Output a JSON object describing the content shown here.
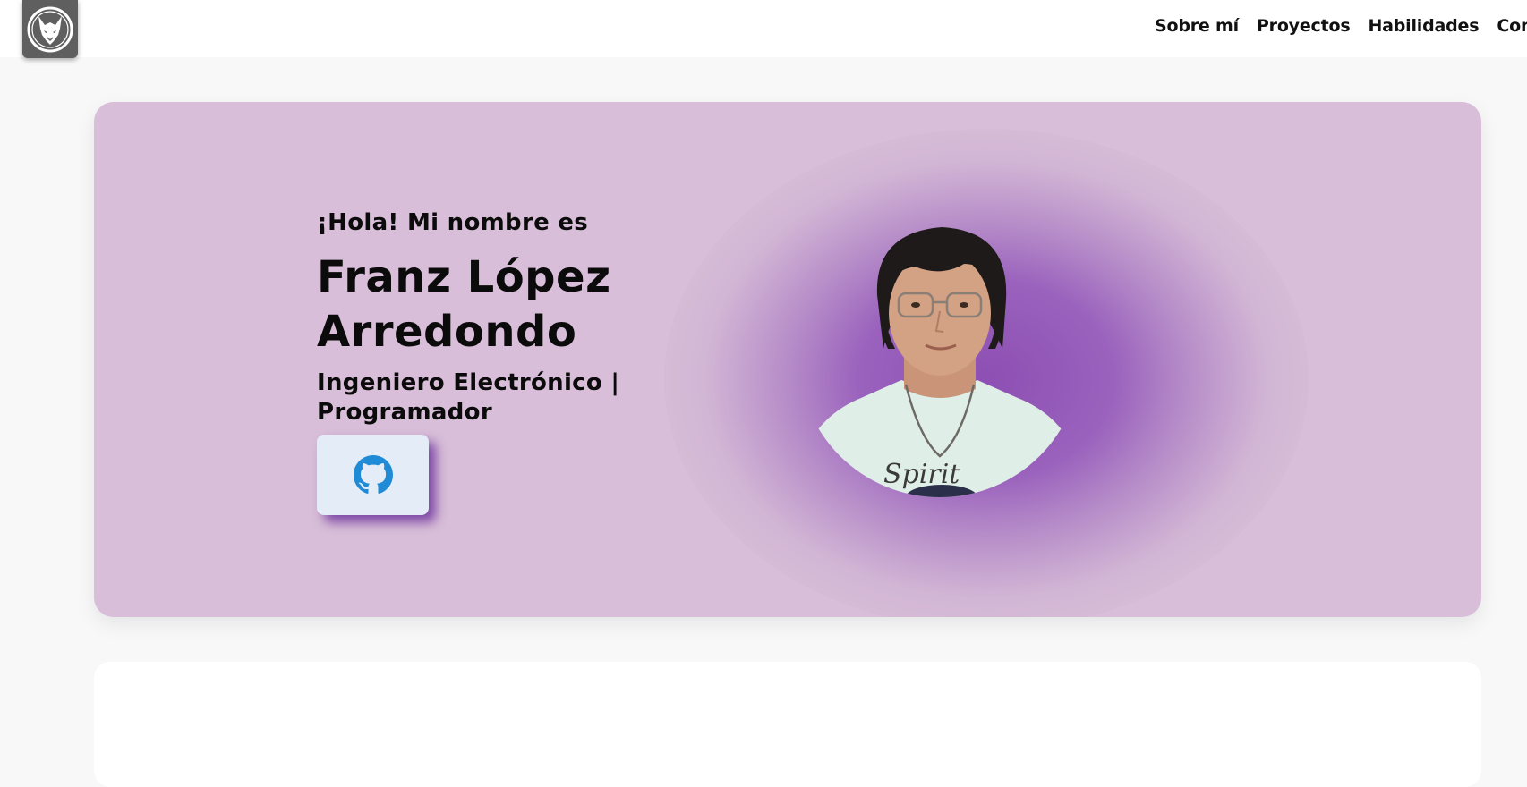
{
  "nav": {
    "items": [
      {
        "label": "Sobre mí"
      },
      {
        "label": "Proyectos"
      },
      {
        "label": "Habilidades"
      },
      {
        "label": "Contacto"
      }
    ]
  },
  "logo": {
    "icon": "wolf-logo-icon"
  },
  "hero": {
    "greeting": "¡Hola! Mi nombre es",
    "name": "Franz López Arredondo",
    "role": "Ingeniero Electrónico | Programador",
    "github_icon": "github-icon",
    "colors": {
      "card_bg": "#d8bed8",
      "glow": "#8d4fb3",
      "button_bg": "#e3ecf7",
      "github_icon": "#1f8ad6",
      "button_shadow": "#602296"
    }
  }
}
